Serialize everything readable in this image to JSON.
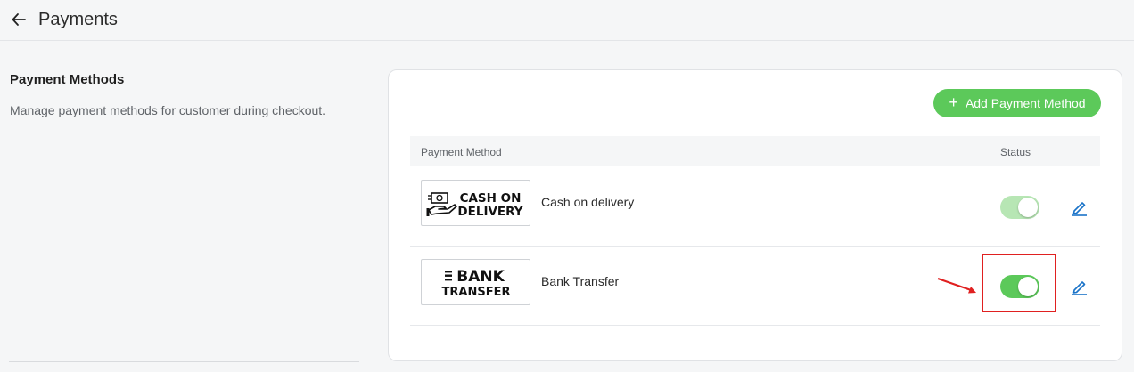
{
  "header": {
    "title": "Payments",
    "back_icon": "arrow-left-icon"
  },
  "section": {
    "title": "Payment Methods",
    "description": "Manage payment methods for customer during checkout."
  },
  "toolbar": {
    "add_label": "Add Payment Method",
    "add_icon": "plus-icon"
  },
  "table": {
    "columns": [
      "Payment Method",
      "Status"
    ],
    "rows": [
      {
        "logo_lines": [
          "CASH ON",
          "DELIVERY"
        ],
        "logo_icon": "cash-hand-icon",
        "name": "Cash on delivery",
        "status": "enabled"
      },
      {
        "logo_lines": [
          "BANK",
          "TRANSFER"
        ],
        "logo_icon": "bank-lines-icon",
        "name": "Bank Transfer",
        "status": "enabled"
      }
    ]
  },
  "colors": {
    "accent_green": "#5cc95a",
    "toggle_light_green": "#b7e6b4",
    "edit_blue": "#1a73c8",
    "highlight_red": "#e02020"
  }
}
